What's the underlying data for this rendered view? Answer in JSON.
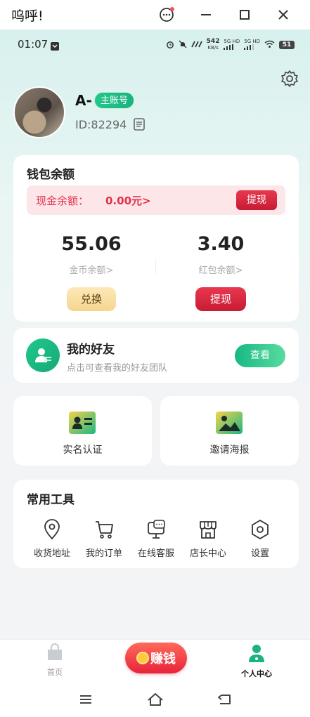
{
  "window": {
    "title": "呜呼!"
  },
  "status": {
    "time": "01:07",
    "net_speed_top": "542",
    "net_speed_unit": "KB/s",
    "sim1": "5G HD",
    "sim2": "5G HD",
    "battery": "51"
  },
  "profile": {
    "name": "A-",
    "badge": "主账号",
    "id_text": "ID:82294"
  },
  "wallet": {
    "title": "钱包余额",
    "cash_label": "现金余额：",
    "cash_value": "0.00元>",
    "cash_withdraw_label": "提现",
    "coins_value": "55.06",
    "coins_label": "金币余额>",
    "redpacket_value": "3.40",
    "redpacket_label": "红包余额>",
    "exchange_label": "兑换",
    "withdraw_label": "提现"
  },
  "friends": {
    "title": "我的好友",
    "subtitle": "点击可查看我的好友团队",
    "view_label": "查看"
  },
  "tiles": [
    {
      "label": "实名认证",
      "icon": "id-card-icon"
    },
    {
      "label": "邀请海报",
      "icon": "poster-image-icon"
    }
  ],
  "tools": {
    "title": "常用工具",
    "items": [
      {
        "label": "收货地址",
        "icon": "location-pin-icon"
      },
      {
        "label": "我的订单",
        "icon": "cart-icon"
      },
      {
        "label": "在线客服",
        "icon": "customer-service-icon"
      },
      {
        "label": "店长中心",
        "icon": "store-icon"
      },
      {
        "label": "设置",
        "icon": "hexagon-settings-icon"
      }
    ]
  },
  "nav": {
    "home_label": "首页",
    "earn_label": "赚钱",
    "profile_label": "个人中心"
  },
  "colors": {
    "accent_green": "#1bb37f",
    "accent_red": "#e0324b",
    "gold": "#f6d58e"
  }
}
